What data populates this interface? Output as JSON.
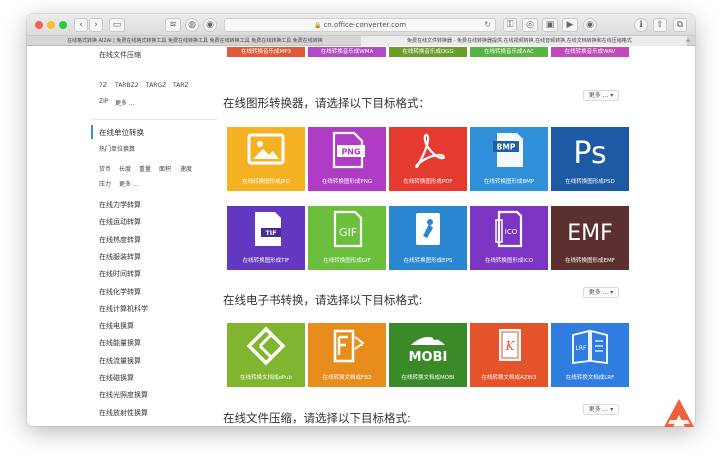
{
  "browser": {
    "url": "cn.office-converter.com",
    "tabs": [
      "在线格式转换 AI2AI | 免费在线格式转换工具 免费在线转换工具 免费在线转换工具 免费在线转换工具 免费在线转换",
      "免费在线文件转换器 - 免费在线转换器提供,在线视频转换,在线音频转换,在线文档转换和在线压缩格式"
    ]
  },
  "sidebar": {
    "archive_title": "在线文件压缩",
    "archive_formats": [
      "7Z",
      "TARBZ2",
      "TARGZ",
      "TARZ"
    ],
    "archive_more": [
      "ZIP",
      "更多 ..."
    ],
    "unit_title": "在线单位转换",
    "unit_hot": "热门单位换算",
    "unit_items_1": [
      "货币",
      "长度",
      "重量",
      "面积",
      "速度"
    ],
    "unit_items_2": [
      "压力",
      "更多 ..."
    ],
    "categories": [
      "在线力学转算",
      "在线运动转算",
      "在线热度转算",
      "在线服装转算",
      "在线时间转算",
      "在线化学转算",
      "在线计算机科学",
      "在线电换算",
      "在线能量换算",
      "在线流量换算",
      "在线磁换算",
      "在线光照度换算",
      "在线放射性换算"
    ]
  },
  "audio_strip": [
    "在线转换音乐成MP3",
    "在线转换音乐成WMA",
    "在线转换音乐成OGG",
    "在线转换音乐成AAC",
    "在线转换音乐成WAV"
  ],
  "image_section": {
    "heading": "在线图形转换器，请选择以下目标格式：",
    "more": "更多 ...",
    "row1": [
      "在线转换图形成JPG",
      "在线转换图形成PNG",
      "在线转换图形成PDF",
      "在线转换图形成BMP",
      "在线转换图形成PSD"
    ],
    "row2": [
      "在线转换图形成TIF",
      "在线转换图形成GIF",
      "在线转换图形成EPS",
      "在线转换图形成ICO",
      "在线转换图形成EMF"
    ],
    "icon_text": {
      "png": "PNG",
      "bmp": "BMP",
      "ps": "Ps",
      "tif": "TIF",
      "gif": "GIF",
      "ico": "ICO",
      "emf": "EMF"
    }
  },
  "ebook_section": {
    "heading": "在线电子书转换，请选择以下目标格式:",
    "more": "更多 ...",
    "row": [
      "在线转换文档成ePub",
      "在线转换文档成FB2",
      "在线转换文档成MOBI",
      "在线转换文档成AZW3",
      "在线转换文档成LRF"
    ],
    "icon_text": {
      "mobi": "MOBI",
      "lrf": "LRF",
      "fb2": "2"
    }
  },
  "archive_section": {
    "heading": "在线文件压缩，请选择以下目标格式:",
    "more": "更多 ..."
  },
  "colors": {
    "jpg": "#f4b223",
    "png": "#b03bc4",
    "pdf": "#e53a2f",
    "bmp": "#2f8fd8",
    "psd": "#1c5aa4",
    "tif": "#6437c0",
    "gif": "#6bbf3c",
    "eps": "#2a86d0",
    "ico": "#7b35c2",
    "emf": "#5d3030",
    "epub": "#7fb52f",
    "fb2": "#e88d1c",
    "mobi": "#3b8a2a",
    "azw3": "#e4532a",
    "lrf": "#2f7de0",
    "strip": [
      "#e05a3a",
      "#b04ac6",
      "#6a9e2a",
      "#58b340",
      "#c04ab8"
    ]
  }
}
